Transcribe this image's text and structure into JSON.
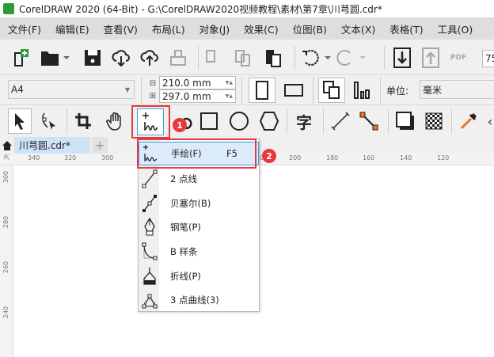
{
  "title": "CorelDRAW 2020 (64-Bit) - G:\\CorelDRAW2020视频教程\\素材\\第7章\\川芎圆.cdr*",
  "menu": [
    "文件(F)",
    "编辑(E)",
    "查看(V)",
    "布局(L)",
    "对象(J)",
    "效果(C)",
    "位图(B)",
    "文本(X)",
    "表格(T)",
    "工具(O)"
  ],
  "toolbar": {
    "zoom_value": "75",
    "pdf_label": "PDF"
  },
  "property_bar": {
    "page_size": "A4",
    "width": "210.0 mm",
    "height": "297.0 mm",
    "units_label": "单位:",
    "units_value": "毫米"
  },
  "toolbox": {
    "text_tool_glyph": "字"
  },
  "document_tab": "川芎圆.cdr*",
  "ruler_h": [
    "340",
    "320",
    "300",
    "220",
    "200",
    "180",
    "160",
    "140",
    "120"
  ],
  "ruler_v": [
    "300",
    "280",
    "260",
    "240"
  ],
  "flyout": [
    {
      "label": "手绘(F)",
      "shortcut": "F5",
      "icon": "freehand-icon"
    },
    {
      "label": "2 点线",
      "icon": "two-point-line-icon"
    },
    {
      "label": "贝塞尔(B)",
      "icon": "bezier-icon"
    },
    {
      "label": "钢笔(P)",
      "icon": "pen-icon"
    },
    {
      "label": "B 样条",
      "icon": "b-spline-icon"
    },
    {
      "label": "折线(P)",
      "icon": "polyline-icon"
    },
    {
      "label": "3 点曲线(3)",
      "icon": "three-point-curve-icon"
    }
  ],
  "annotations": [
    "1",
    "2"
  ],
  "colors": {
    "highlight": "#e8393c",
    "selection": "#dcebfa",
    "menu_bg": "#dedede"
  }
}
